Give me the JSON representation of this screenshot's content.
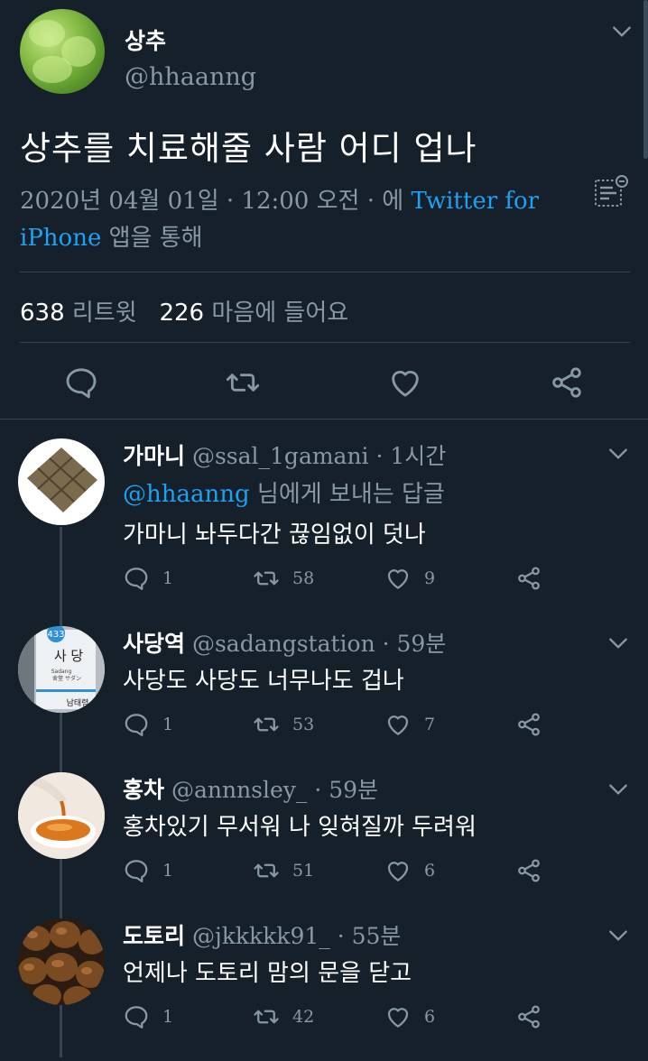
{
  "main_tweet": {
    "name": "상추",
    "handle": "@hhaanng",
    "text": "상추를 치료해줄 사람 어디 업나",
    "date": "2020년 04월 01일 · 12:00 오전 · 에",
    "source_link": "Twitter for",
    "source_link2": "iPhone",
    "source_suffix": "앱을 통해",
    "retweets": "638",
    "retweets_label": "리트윗",
    "likes": "226",
    "likes_label": "마음에 들어요"
  },
  "replies": [
    {
      "name": "가마니",
      "meta": "@ssal_1gamani · 1시간",
      "reply_to_handle": "@hhaanng",
      "reply_to_suffix": "님에게 보내는 답글",
      "text": "가마니 놔두다간 끊임없이 덧나",
      "replies": "1",
      "retweets": "58",
      "likes": "9"
    },
    {
      "name": "사당역",
      "meta": "@sadangstation · 59분",
      "text": "사당도 사당도 너무나도 겁나",
      "replies": "1",
      "retweets": "53",
      "likes": "7",
      "sign_big": "사 당",
      "sign_small": "Sadang",
      "sign_jp": "舍堂 サダン",
      "sign_bottom": "남태령",
      "sign_num": "433"
    },
    {
      "name": "홍차",
      "meta": "@annnsley_ · 59분",
      "text": "홍차있기 무서워 나 잊혀질까 두려워",
      "replies": "1",
      "retweets": "51",
      "likes": "6"
    },
    {
      "name": "도토리",
      "meta": "@jkkkkk91_ · 55분",
      "text": "언제나 도토리 맘의 문을 닫고",
      "replies": "1",
      "retweets": "42",
      "likes": "6"
    }
  ],
  "icons": {
    "reply": "reply-icon",
    "retweet": "retweet-icon",
    "like": "heart-icon",
    "share": "share-icon",
    "more": "chevron-down-icon"
  },
  "colors": {
    "background": "#15202b",
    "accent": "#1da1f2",
    "muted": "#8899a6",
    "divider": "#38444d"
  }
}
